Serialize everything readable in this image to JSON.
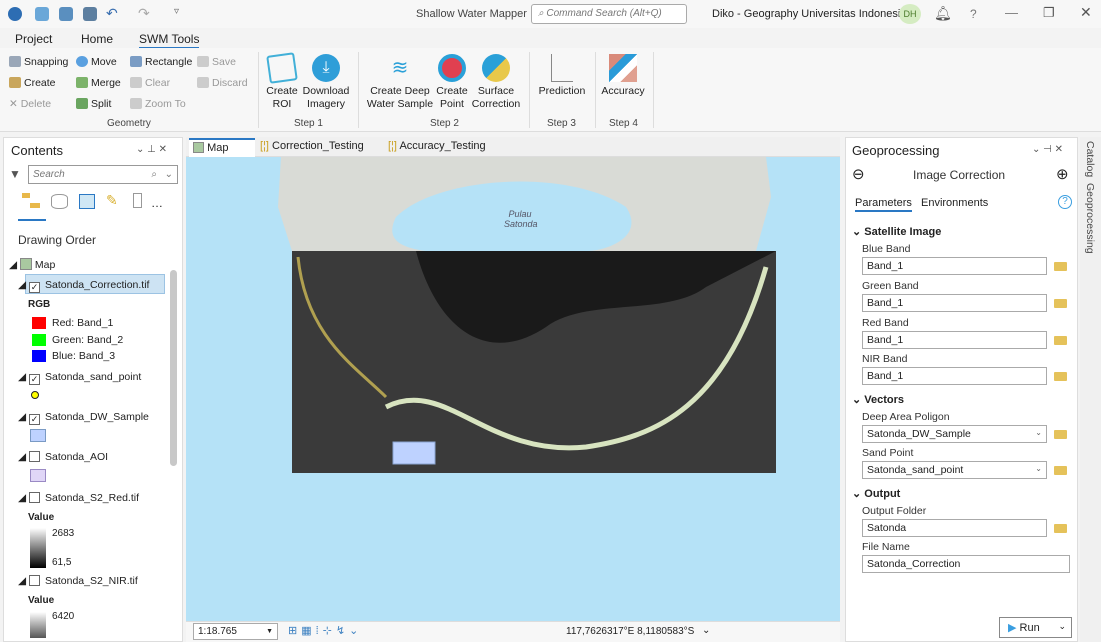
{
  "app": {
    "title": "Shallow Water Mapper",
    "search_placeholder": "Command Search (Alt+Q)",
    "user": "Diko - Geography Universitas Indonesia",
    "avatar": "DH"
  },
  "menu_tabs": [
    "Project",
    "Home",
    "SWM Tools"
  ],
  "ribbon": {
    "geometry": {
      "items": [
        "Snapping",
        "Move",
        "Rectangle",
        "Save",
        "Create",
        "Merge",
        "Clear",
        "Discard",
        "Delete",
        "Split",
        "Zoom To"
      ],
      "label": "Geometry"
    },
    "step1": {
      "buttons": [
        "Create ROI",
        "Download Imagery"
      ],
      "label": "Step 1"
    },
    "step2": {
      "buttons": [
        "Create Deep Water Sample",
        "Create Point",
        "Surface Correction"
      ],
      "label": "Step 2"
    },
    "step3": {
      "buttons": [
        "Prediction"
      ],
      "label": "Step 3"
    },
    "step4": {
      "buttons": [
        "Accuracy"
      ],
      "label": "Step 4"
    }
  },
  "contents": {
    "title": "Contents",
    "search_placeholder": "Search",
    "heading": "Drawing Order",
    "map": "Map",
    "layers": [
      {
        "name": "Satonda_Correction.tif",
        "checked": true,
        "rgb_label": "RGB",
        "bands": [
          {
            "label": "Red:  Band_1",
            "color": "#ff0000"
          },
          {
            "label": "Green: Band_2",
            "color": "#00ff00"
          },
          {
            "label": "Blue:  Band_3",
            "color": "#0000ff"
          }
        ]
      },
      {
        "name": "Satonda_sand_point",
        "checked": true,
        "color": "#ffff00"
      },
      {
        "name": "Satonda_DW_Sample",
        "checked": true,
        "color": "#bed2ff"
      },
      {
        "name": "Satonda_AOI",
        "checked": false,
        "color": "#e0d6f7"
      },
      {
        "name": "Satonda_S2_Red.tif",
        "checked": false,
        "value_label": "Value",
        "max": "2683",
        "min": "61,5"
      },
      {
        "name": "Satonda_S2_NIR.tif",
        "checked": false,
        "value_label": "Value",
        "max": "6420"
      }
    ]
  },
  "map_tabs": [
    "Map",
    "Correction_Testing",
    "Accuracy_Testing"
  ],
  "map": {
    "label_line1": "Pulau",
    "label_line2": "Satonda",
    "scale": "1:18.765",
    "coords": "117,7626317°E 8,1180583°S"
  },
  "geoprocessing": {
    "title": "Geoprocessing",
    "tool": "Image Correction",
    "tabs": [
      "Parameters",
      "Environments"
    ],
    "sections": {
      "satellite": "Satellite Image",
      "vectors": "Vectors",
      "output": "Output"
    },
    "fields": {
      "blue_label": "Blue Band",
      "blue": "Band_1",
      "green_label": "Green Band",
      "green": "Band_1",
      "red_label": "Red Band",
      "red": "Band_1",
      "nir_label": "NIR Band",
      "nir": "Band_1",
      "deep_label": "Deep Area Poligon",
      "deep": "Satonda_DW_Sample",
      "sand_label": "Sand Point",
      "sand": "Satonda_sand_point",
      "folder_label": "Output Folder",
      "folder": "Satonda",
      "file_label": "File Name",
      "file": "Satonda_Correction"
    },
    "run": "Run"
  },
  "side_tabs": [
    "Catalog",
    "Geoprocessing"
  ]
}
